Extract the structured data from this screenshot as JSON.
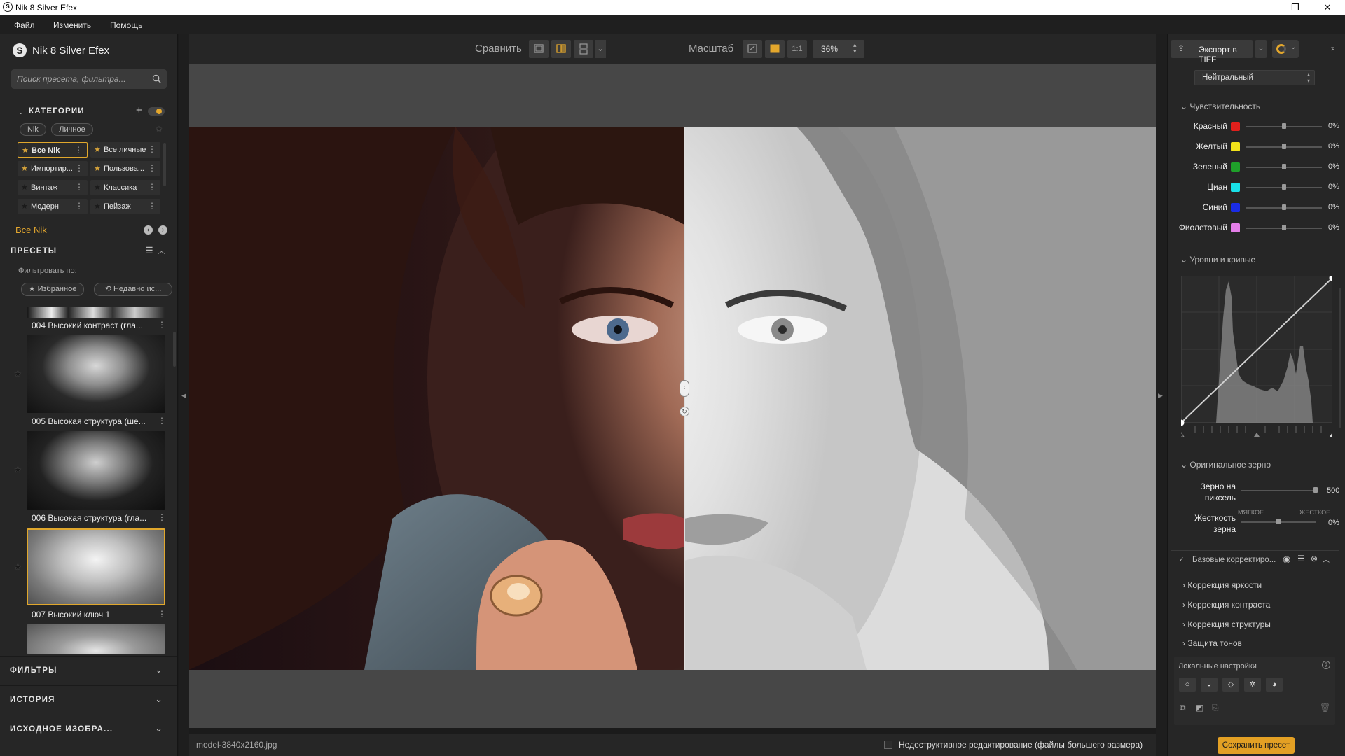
{
  "window": {
    "title": "Nik 8 Silver Efex",
    "controls": [
      "—",
      "❐",
      "✕"
    ]
  },
  "menu": [
    "Файл",
    "Изменить",
    "Помощь"
  ],
  "brand": {
    "logo_letter": "S",
    "name": "Nik 8 Silver Efex"
  },
  "search": {
    "placeholder": "Поиск пресета, фильтра..."
  },
  "categories": {
    "header": "КАТЕГОРИИ",
    "tabs": [
      "Nik",
      "Личное"
    ],
    "items": [
      {
        "label": "Все Nik",
        "selected": true
      },
      {
        "label": "Все личные",
        "selected": false
      },
      {
        "label": "Импортир...",
        "selected": false
      },
      {
        "label": "Пользова...",
        "selected": false
      },
      {
        "label": "Винтаж",
        "selected": false
      },
      {
        "label": "Классика",
        "selected": false
      },
      {
        "label": "Модерн",
        "selected": false
      },
      {
        "label": "Пейзаж",
        "selected": false
      }
    ],
    "current": "Все Nik"
  },
  "presets": {
    "header": "ПРЕСЕТЫ",
    "filter_label": "Фильтровать по:",
    "filter_chips": [
      "★ Избранное",
      "⟲ Недавно ис..."
    ],
    "items": [
      {
        "label": "004 Высокий контраст (гла...",
        "selected": false
      },
      {
        "label": "005 Высокая структура (ше...",
        "selected": false
      },
      {
        "label": "006 Высокая структура (гла...",
        "selected": false
      },
      {
        "label": "007 Высокий ключ 1",
        "selected": true
      }
    ]
  },
  "collapsed_sections": [
    "ФИЛЬТРЫ",
    "ИСТОРИЯ",
    "ИСХОДНОЕ ИЗОБРА..."
  ],
  "toolbar": {
    "compare_label": "Сравнить",
    "zoom_label": "Масштаб",
    "one_to_one": "1:1",
    "zoom_value": "36%"
  },
  "status": {
    "filename": "model-3840x2160.jpg",
    "nondestructive": "Недеструктивное редактирование (файлы большего размера)"
  },
  "right": {
    "export_label": "Экспорт в TIFF",
    "preset_select": "Нейтральный",
    "sensitivity_header": "Чувствительность",
    "sensitivity": [
      {
        "name": "Красный",
        "color": "#e0201c",
        "value": "0%",
        "level": 0.5
      },
      {
        "name": "Желтый",
        "color": "#f2e21a",
        "value": "0%",
        "level": 0.5
      },
      {
        "name": "Зеленый",
        "color": "#1fa02a",
        "value": "0%",
        "level": 0.5
      },
      {
        "name": "Циан",
        "color": "#19e0e8",
        "value": "0%",
        "level": 0.5
      },
      {
        "name": "Синий",
        "color": "#1a2ce6",
        "value": "0%",
        "level": 0.5
      },
      {
        "name": "Фиолетовый",
        "color": "#e47ee8",
        "value": "0%",
        "level": 0.5
      }
    ],
    "levels_header": "Уровни и кривые",
    "grain_header": "Оригинальное зерно",
    "grain_per_pixel": {
      "label1": "Зерно на",
      "label2": "пиксель",
      "value": "500"
    },
    "grain_hardness": {
      "label1": "Жесткость",
      "label2": "зерна",
      "soft": "МЯГКОЕ",
      "hard": "ЖЕСТКОЕ",
      "value": "0%"
    },
    "basic_label": "Базовые корректиро...",
    "basic_items": [
      "Коррекция яркости",
      "Коррекция контраста",
      "Коррекция структуры",
      "Защита тонов"
    ],
    "local_label": "Локальные настройки",
    "save_preset": "Сохранить пресет"
  }
}
